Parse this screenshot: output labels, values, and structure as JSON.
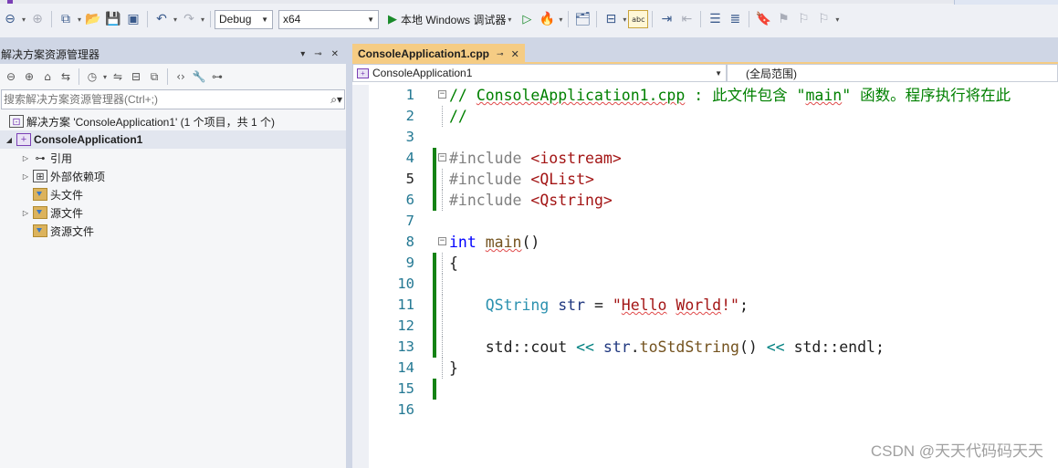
{
  "toolbar": {
    "config": "Debug",
    "platform": "x64",
    "run_label": "本地 Windows 调试器",
    "spell_label": "abc"
  },
  "solution_explorer": {
    "title": "解决方案资源管理器",
    "search_placeholder": "搜索解决方案资源管理器(Ctrl+;)",
    "tree": [
      {
        "label": "解决方案 'ConsoleApplication1' (1 个项目，共 1 个)",
        "type": "solution",
        "indent": 0,
        "bold": false,
        "expander": "none"
      },
      {
        "label": "ConsoleApplication1",
        "type": "project",
        "indent": 1,
        "bold": true,
        "expander": "expanded"
      },
      {
        "label": "引用",
        "type": "references",
        "indent": 2,
        "bold": false,
        "expander": "collapsed"
      },
      {
        "label": "外部依赖项",
        "type": "external",
        "indent": 2,
        "bold": false,
        "expander": "collapsed"
      },
      {
        "label": "头文件",
        "type": "filter",
        "indent": 2,
        "bold": false,
        "expander": "none"
      },
      {
        "label": "源文件",
        "type": "filter",
        "indent": 2,
        "bold": false,
        "expander": "collapsed"
      },
      {
        "label": "资源文件",
        "type": "filter",
        "indent": 2,
        "bold": false,
        "expander": "none"
      }
    ]
  },
  "editor": {
    "tab_label": "ConsoleApplication1.cpp",
    "tab_pin": "⊸",
    "tab_close": "✕",
    "nav_left": "ConsoleApplication1",
    "nav_right": "(全局范围)",
    "current_line": 5,
    "lines": [
      {
        "n": "1",
        "text": "// ConsoleApplication1.cpp : 此文件包含 \"main\" 函数。程序执行将在此"
      },
      {
        "n": "2",
        "text": "//"
      },
      {
        "n": "3",
        "text": ""
      },
      {
        "n": "4",
        "text": "#include <iostream>"
      },
      {
        "n": "5",
        "text": "#include <QList>"
      },
      {
        "n": "6",
        "text": "#include <Qstring>"
      },
      {
        "n": "7",
        "text": ""
      },
      {
        "n": "8",
        "text": "int main()"
      },
      {
        "n": "9",
        "text": "{"
      },
      {
        "n": "10",
        "text": ""
      },
      {
        "n": "11",
        "text": "    QString str = \"Hello World!\";"
      },
      {
        "n": "12",
        "text": ""
      },
      {
        "n": "13",
        "text": "    std::cout << str.toStdString() << std::endl;"
      },
      {
        "n": "14",
        "text": "}"
      },
      {
        "n": "15",
        "text": ""
      },
      {
        "n": "16",
        "text": ""
      }
    ]
  },
  "watermark": "CSDN @天天代码码天天",
  "colors": {
    "accent_tab": "#f5cc84",
    "chrome": "#cfd6e5",
    "change_bar": "#148214"
  }
}
